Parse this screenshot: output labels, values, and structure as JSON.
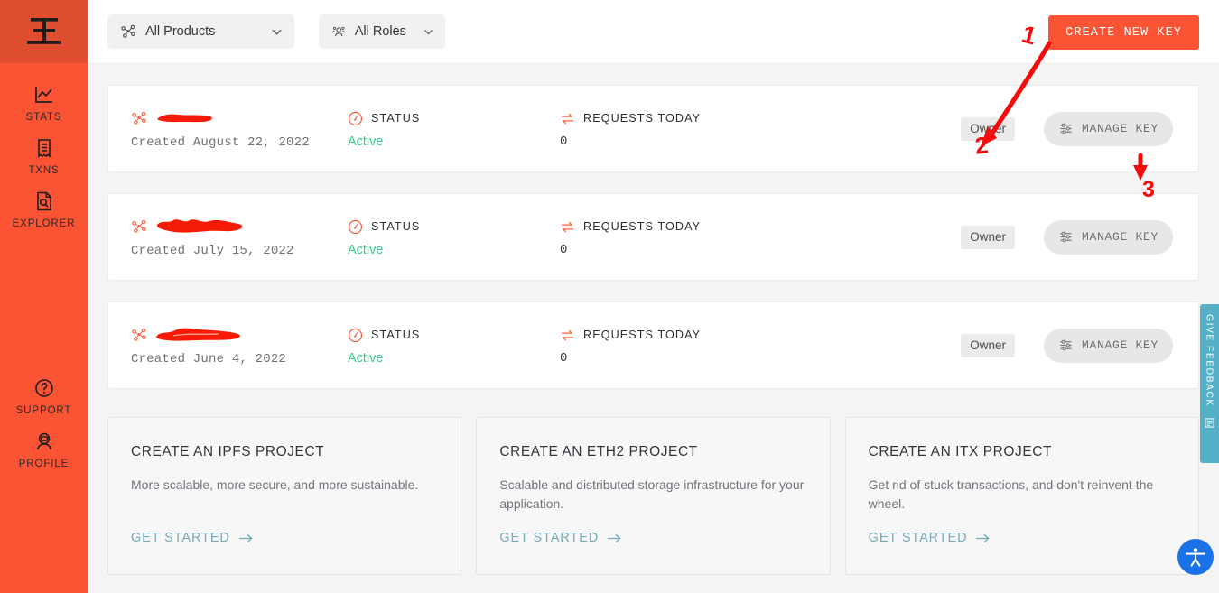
{
  "brand": {
    "accent": "#fb5435",
    "sidebar_bg": "#fb5435",
    "logo_icon": "infura-cube-logo-icon",
    "status_green": "#3dc98f",
    "link_blue": "#77aabb",
    "feedback_teal": "#54b0c6",
    "a11y_blue": "#1b72e8"
  },
  "sidebar": {
    "items": [
      {
        "label": "STATS",
        "icon": "line-chart-icon"
      },
      {
        "label": "TXNS",
        "icon": "receipt-icon"
      },
      {
        "label": "EXPLORER",
        "icon": "document-search-icon"
      },
      {
        "label": "SUPPORT",
        "icon": "question-circle-icon"
      },
      {
        "label": "PROFILE",
        "icon": "astronaut-avatar-icon"
      }
    ]
  },
  "topbar": {
    "filters": [
      {
        "label": "All Products",
        "icon": "network-nodes-icon",
        "chevron": "chevron-down-icon"
      },
      {
        "label": "All Roles",
        "icon": "people-group-icon",
        "chevron": "chevron-down-icon"
      }
    ],
    "create_key_label": "CREATE NEW KEY"
  },
  "labels": {
    "status_heading": "STATUS",
    "requests_heading": "REQUESTS TODAY",
    "status_icon": "gauge-icon",
    "requests_icon": "transfer-arrows-icon",
    "product_icon": "network-nodes-icon",
    "manage_key_label": "MANAGE KEY",
    "manage_key_icon": "sliders-icon"
  },
  "keys": [
    {
      "name_redacted": "████████",
      "created": "Created August 22, 2022",
      "status": "Active",
      "requests_today": "0",
      "role": "Owner",
      "manage_label": "MANAGE KEY"
    },
    {
      "name_redacted": "███████████",
      "created": "Created July 15, 2022",
      "status": "Active",
      "requests_today": "0",
      "role": "Owner",
      "manage_label": "MANAGE KEY"
    },
    {
      "name_redacted": "██████████",
      "created": "Created June 4, 2022",
      "status": "Active",
      "requests_today": "0",
      "role": "Owner",
      "manage_label": "MANAGE KEY"
    }
  ],
  "promos": [
    {
      "title": "CREATE AN IPFS PROJECT",
      "body": "More scalable, more secure, and more sustainable.",
      "link": "GET STARTED",
      "link_icon": "arrow-right-icon"
    },
    {
      "title": "CREATE AN ETH2 PROJECT",
      "body": "Scalable and distributed storage infrastructure for your application.",
      "link": "GET STARTED",
      "link_icon": "arrow-right-icon"
    },
    {
      "title": "CREATE AN ITX PROJECT",
      "body": "Get rid of stuck transactions, and don't reinvent the wheel.",
      "link": "GET STARTED",
      "link_icon": "arrow-right-icon"
    }
  ],
  "feedback": {
    "label": "GIVE FEEDBACK",
    "icon": "feedback-form-icon"
  },
  "a11y": {
    "icon": "accessibility-person-icon"
  },
  "annotations": {
    "marks": [
      {
        "id": "1",
        "text": "1"
      },
      {
        "id": "2",
        "text": "2"
      },
      {
        "id": "3",
        "text": "3"
      }
    ],
    "color": "#f20d0d"
  }
}
